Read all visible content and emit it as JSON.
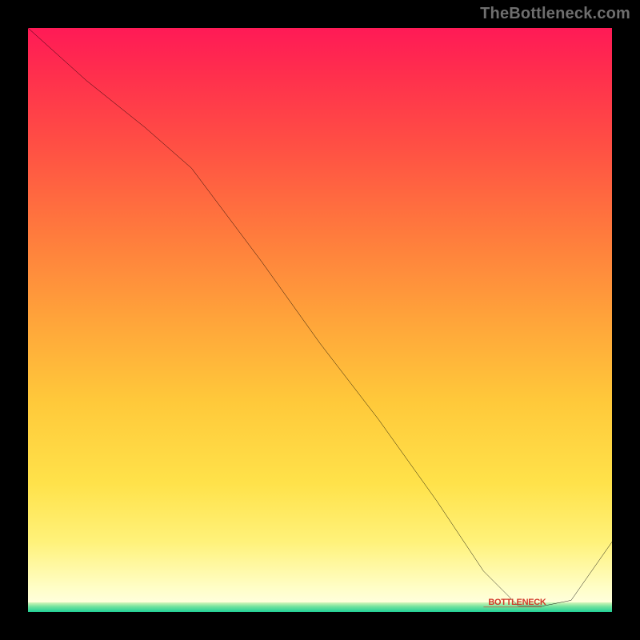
{
  "watermark": "TheBottleneck.com",
  "chart_data": {
    "type": "line",
    "title": "",
    "xlabel": "",
    "ylabel": "",
    "xlim": [
      0,
      100
    ],
    "ylim": [
      0,
      100
    ],
    "series": [
      {
        "name": "curve",
        "x": [
          0,
          10,
          20,
          28,
          40,
          50,
          60,
          70,
          78,
          84,
          88,
          93,
          100
        ],
        "y": [
          100,
          91,
          83,
          76,
          60,
          46,
          33,
          19,
          7,
          1,
          1,
          2,
          12
        ]
      }
    ],
    "background_gradient": {
      "top": "#ff1a56",
      "mid": "#ffc93a",
      "bottom_band": "#1fcf96"
    },
    "bottom_marker_label": "BOTTLENECK"
  }
}
